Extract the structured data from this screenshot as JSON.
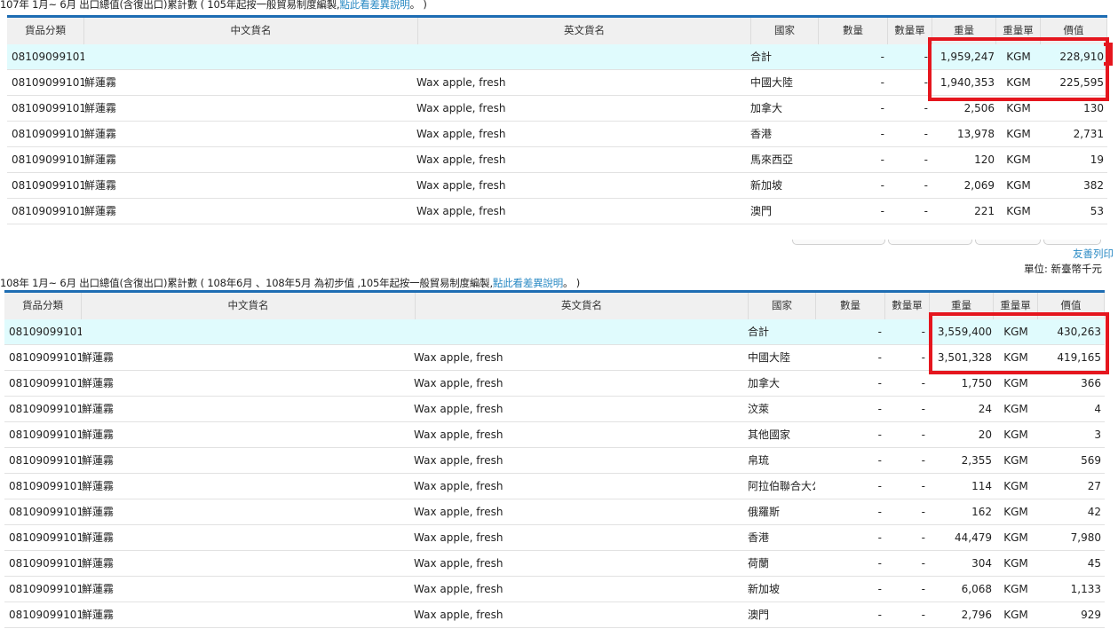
{
  "section1": {
    "caption": "107年 1月~ 6月 出口總值(含復出口)累計數 ( 105年起按一般貿易制度編製,",
    "caption_link": "點此看差異說明",
    "caption_end": "。 )",
    "rows": [
      {
        "code": "08109099101",
        "cn": "",
        "en": "",
        "country": "合計",
        "qty": "-",
        "qty_unit": "-",
        "weight": "1,959,247",
        "w_unit": "KGM",
        "value": "228,910",
        "total": true
      },
      {
        "code": "08109099101",
        "cn": "鮮蓮霧",
        "en": "Wax apple, fresh",
        "country": "中國大陸",
        "qty": "-",
        "qty_unit": "-",
        "weight": "1,940,353",
        "w_unit": "KGM",
        "value": "225,595"
      },
      {
        "code": "08109099101",
        "cn": "鮮蓮霧",
        "en": "Wax apple, fresh",
        "country": "加拿大",
        "qty": "-",
        "qty_unit": "-",
        "weight": "2,506",
        "w_unit": "KGM",
        "value": "130"
      },
      {
        "code": "08109099101",
        "cn": "鮮蓮霧",
        "en": "Wax apple, fresh",
        "country": "香港",
        "qty": "-",
        "qty_unit": "-",
        "weight": "13,978",
        "w_unit": "KGM",
        "value": "2,731"
      },
      {
        "code": "08109099101",
        "cn": "鮮蓮霧",
        "en": "Wax apple, fresh",
        "country": "馬來西亞",
        "qty": "-",
        "qty_unit": "-",
        "weight": "120",
        "w_unit": "KGM",
        "value": "19"
      },
      {
        "code": "08109099101",
        "cn": "鮮蓮霧",
        "en": "Wax apple, fresh",
        "country": "新加坡",
        "qty": "-",
        "qty_unit": "-",
        "weight": "2,069",
        "w_unit": "KGM",
        "value": "382"
      },
      {
        "code": "08109099101",
        "cn": "鮮蓮霧",
        "en": "Wax apple, fresh",
        "country": "澳門",
        "qty": "-",
        "qty_unit": "-",
        "weight": "221",
        "w_unit": "KGM",
        "value": "53"
      }
    ]
  },
  "section2": {
    "caption": "108年 1月~ 6月 出口總值(含復出口)累計數 ( 108年6月 、108年5月 為初步值 ,105年起按一般貿易制度編製,",
    "caption_link": "點此看差異說明",
    "caption_end": "。 )",
    "rows": [
      {
        "code": "08109099101",
        "cn": "",
        "en": "",
        "country": "合計",
        "qty": "-",
        "qty_unit": "-",
        "weight": "3,559,400",
        "w_unit": "KGM",
        "value": "430,263",
        "total": true
      },
      {
        "code": "08109099101",
        "cn": "鮮蓮霧",
        "en": "Wax apple, fresh",
        "country": "中國大陸",
        "qty": "-",
        "qty_unit": "-",
        "weight": "3,501,328",
        "w_unit": "KGM",
        "value": "419,165"
      },
      {
        "code": "08109099101",
        "cn": "鮮蓮霧",
        "en": "Wax apple, fresh",
        "country": "加拿大",
        "qty": "-",
        "qty_unit": "-",
        "weight": "1,750",
        "w_unit": "KGM",
        "value": "366"
      },
      {
        "code": "08109099101",
        "cn": "鮮蓮霧",
        "en": "Wax apple, fresh",
        "country": "汶萊",
        "qty": "-",
        "qty_unit": "-",
        "weight": "24",
        "w_unit": "KGM",
        "value": "4"
      },
      {
        "code": "08109099101",
        "cn": "鮮蓮霧",
        "en": "Wax apple, fresh",
        "country": "其他國家",
        "qty": "-",
        "qty_unit": "-",
        "weight": "20",
        "w_unit": "KGM",
        "value": "3"
      },
      {
        "code": "08109099101",
        "cn": "鮮蓮霧",
        "en": "Wax apple, fresh",
        "country": "帛琉",
        "qty": "-",
        "qty_unit": "-",
        "weight": "2,355",
        "w_unit": "KGM",
        "value": "569"
      },
      {
        "code": "08109099101",
        "cn": "鮮蓮霧",
        "en": "Wax apple, fresh",
        "country": "阿拉伯聯合大公",
        "qty": "-",
        "qty_unit": "-",
        "weight": "114",
        "w_unit": "KGM",
        "value": "27"
      },
      {
        "code": "08109099101",
        "cn": "鮮蓮霧",
        "en": "Wax apple, fresh",
        "country": "俄羅斯",
        "qty": "-",
        "qty_unit": "-",
        "weight": "162",
        "w_unit": "KGM",
        "value": "42"
      },
      {
        "code": "08109099101",
        "cn": "鮮蓮霧",
        "en": "Wax apple, fresh",
        "country": "香港",
        "qty": "-",
        "qty_unit": "-",
        "weight": "44,479",
        "w_unit": "KGM",
        "value": "7,980"
      },
      {
        "code": "08109099101",
        "cn": "鮮蓮霧",
        "en": "Wax apple, fresh",
        "country": "荷蘭",
        "qty": "-",
        "qty_unit": "-",
        "weight": "304",
        "w_unit": "KGM",
        "value": "45"
      },
      {
        "code": "08109099101",
        "cn": "鮮蓮霧",
        "en": "Wax apple, fresh",
        "country": "新加坡",
        "qty": "-",
        "qty_unit": "-",
        "weight": "6,068",
        "w_unit": "KGM",
        "value": "1,133"
      },
      {
        "code": "08109099101",
        "cn": "鮮蓮霧",
        "en": "Wax apple, fresh",
        "country": "澳門",
        "qty": "-",
        "qty_unit": "-",
        "weight": "2,796",
        "w_unit": "KGM",
        "value": "929"
      }
    ]
  },
  "columns": [
    "貨品分類",
    "中文貨名",
    "英文貨名",
    "國家",
    "數量",
    "數量單",
    "重量",
    "重量單",
    "價值"
  ],
  "print_link": "友善列印",
  "unit_label": "單位: 新臺幣千元",
  "colors": {
    "accent": "#1e6db3",
    "link": "#2a8ac4",
    "total_row": "#e0fbfd",
    "highlight": "#e5161e"
  }
}
